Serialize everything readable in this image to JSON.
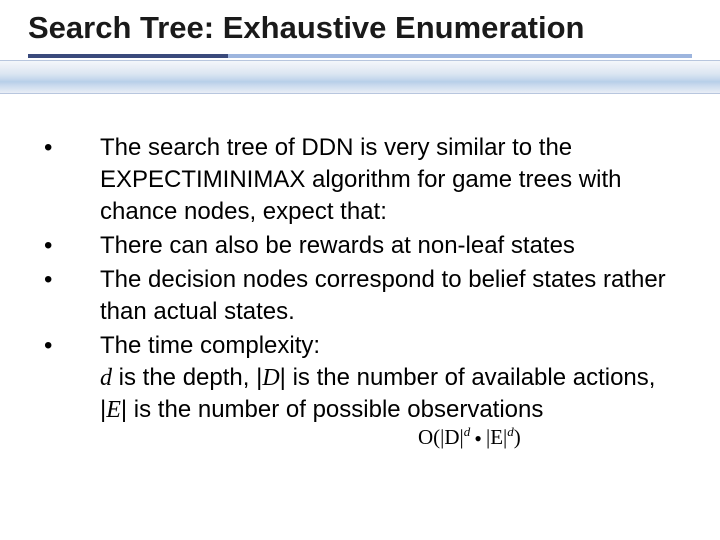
{
  "title": "Search Tree: Exhaustive Enumeration",
  "bullets": [
    "The search tree of DDN is very similar to the EXPECTIMINIMAX algorithm for game trees with chance nodes, expect that:",
    "There can also be rewards at non-leaf states",
    "The decision nodes correspond to belief states rather than actual states.",
    "The time complexity:"
  ],
  "complexity_line": {
    "pre": "",
    "d": "d",
    "text1": " is the depth, |",
    "D": "D",
    "text2": "| is the number of available actions, |",
    "E": "E",
    "text3": "| is the number of possible observations"
  },
  "formula": {
    "pre": "O(|",
    "D": "D",
    "mid1": "|",
    "sup": "d",
    "dot": "•",
    "mid2": "|",
    "E": "E",
    "mid3": "|",
    "sup2": "d",
    "post": ")"
  }
}
